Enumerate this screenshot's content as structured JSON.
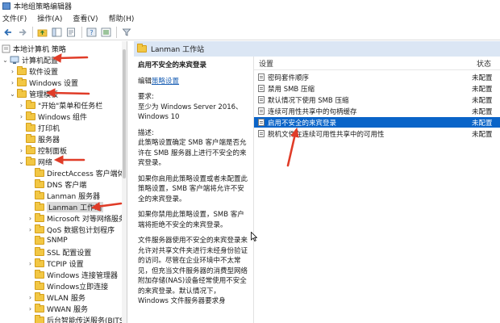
{
  "window": {
    "title": "本地组策略编辑器"
  },
  "menu": {
    "file": "文件(F)",
    "action": "操作(A)",
    "view": "查看(V)",
    "help": "帮助(H)"
  },
  "toolbar": {
    "buttons": [
      "back-icon",
      "forward-icon",
      "up-folder-icon",
      "show-hide-tree-icon",
      "export-list-icon",
      "help-icon",
      "properties-icon",
      "filter-icon"
    ]
  },
  "tree": {
    "items": [
      {
        "label": "本地计算机 策略",
        "icon": "policy-root-icon"
      },
      {
        "label": "计算机配置",
        "icon": "computer-icon"
      },
      {
        "label": "软件设置",
        "icon": "folder-icon"
      },
      {
        "label": "Windows 设置",
        "icon": "folder-icon"
      },
      {
        "label": "管理模板",
        "icon": "folder-icon"
      },
      {
        "label": "\"开始\"菜单和任务栏",
        "icon": "folder-icon"
      },
      {
        "label": "Windows 组件",
        "icon": "folder-icon"
      },
      {
        "label": "打印机",
        "icon": "folder-icon"
      },
      {
        "label": "服务器",
        "icon": "folder-icon"
      },
      {
        "label": "控制面板",
        "icon": "folder-icon"
      },
      {
        "label": "网络",
        "icon": "folder-icon"
      },
      {
        "label": "DirectAccess 客户端体验",
        "icon": "folder-icon"
      },
      {
        "label": "DNS 客户端",
        "icon": "folder-icon"
      },
      {
        "label": "Lanman 服务器",
        "icon": "folder-icon"
      },
      {
        "label": "Lanman 工作站",
        "icon": "folder-icon"
      },
      {
        "label": "Microsoft 对等网络服务",
        "icon": "folder-icon"
      },
      {
        "label": "QoS 数据包计划程序",
        "icon": "folder-icon"
      },
      {
        "label": "SNMP",
        "icon": "folder-icon"
      },
      {
        "label": "SSL 配置设置",
        "icon": "folder-icon"
      },
      {
        "label": "TCPIP 设置",
        "icon": "folder-icon"
      },
      {
        "label": "Windows 连接管理器",
        "icon": "folder-icon"
      },
      {
        "label": "Windows立即连接",
        "icon": "folder-icon"
      },
      {
        "label": "WLAN 服务",
        "icon": "folder-icon"
      },
      {
        "label": "WWAN 服务",
        "icon": "folder-icon"
      },
      {
        "label": "后台智能传送服务(BITS)",
        "icon": "folder-icon"
      }
    ]
  },
  "header": {
    "folder_title": "Lanman 工作站"
  },
  "description": {
    "policy_title": "启用不安全的来宾登录",
    "edit_prefix": "编辑",
    "edit_link": "策略设置",
    "requirements_label": "要求:",
    "requirements_value": "至少为 Windows Server 2016、Windows 10",
    "desc_label": "描述:",
    "p1": "此策略设置确定 SMB 客户端是否允许在 SMB 服务器上进行不安全的来宾登录。",
    "p2": "如果你启用此策略设置或者未配置此策略设置，SMB 客户端将允许不安全的来宾登录。",
    "p3": "如果你禁用此策略设置，SMB 客户端将拒绝不安全的来宾登录。",
    "p4": "文件服务器使用不安全的来宾登录来允许对共享文件夹进行未经身份验证的访问。尽管在企业环境中不太常见，但充当文件服务器的消费型网络附加存储(NAS)设备经常使用不安全的来宾登录。默认情况下，Windows 文件服务器要求身"
  },
  "list": {
    "col_setting": "设置",
    "col_state": "状态",
    "rows": [
      {
        "name": "密码套件顺序",
        "state": "未配置",
        "selected": false
      },
      {
        "name": "禁用 SMB 压缩",
        "state": "未配置",
        "selected": false
      },
      {
        "name": "默认情况下使用 SMB 压缩",
        "state": "未配置",
        "selected": false
      },
      {
        "name": "连续可用性共享中的句柄缓存",
        "state": "未配置",
        "selected": false
      },
      {
        "name": "启用不安全的来宾登录",
        "state": "未配置",
        "selected": true
      },
      {
        "name": "脱机文件在连续可用性共享中的可用性",
        "state": "未配置",
        "selected": false
      }
    ]
  },
  "colors": {
    "selection": "#0a64c8",
    "annotation_arrow": "#e03c28",
    "folder": "#f2c744",
    "header_bg": "#dbe6f4"
  }
}
